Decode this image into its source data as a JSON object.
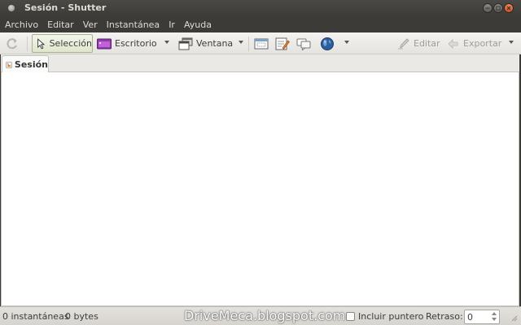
{
  "window": {
    "title": "Sesión - Shutter"
  },
  "menubar": {
    "items": [
      "Archivo",
      "Editar",
      "Ver",
      "Instantánea",
      "Ir",
      "Ayuda"
    ]
  },
  "toolbar": {
    "selection_label": "Selección",
    "desktop_label": "Escritorio",
    "window_label": "Ventana",
    "edit_label": "Editar",
    "export_label": "Exportar"
  },
  "tabs": [
    {
      "label": "Sesión"
    }
  ],
  "status": {
    "snapshots": "0 instantáneas",
    "size": "0 bytes",
    "watermark": "DriveMeca.blogspot.com",
    "include_pointer_label": "Incluir puntero",
    "delay_label": "Retraso:",
    "delay_value": "0"
  },
  "colors": {
    "close_button": "#d9501e",
    "titlebar": "#3c3b37",
    "selection_accent": "#a8b58a"
  }
}
